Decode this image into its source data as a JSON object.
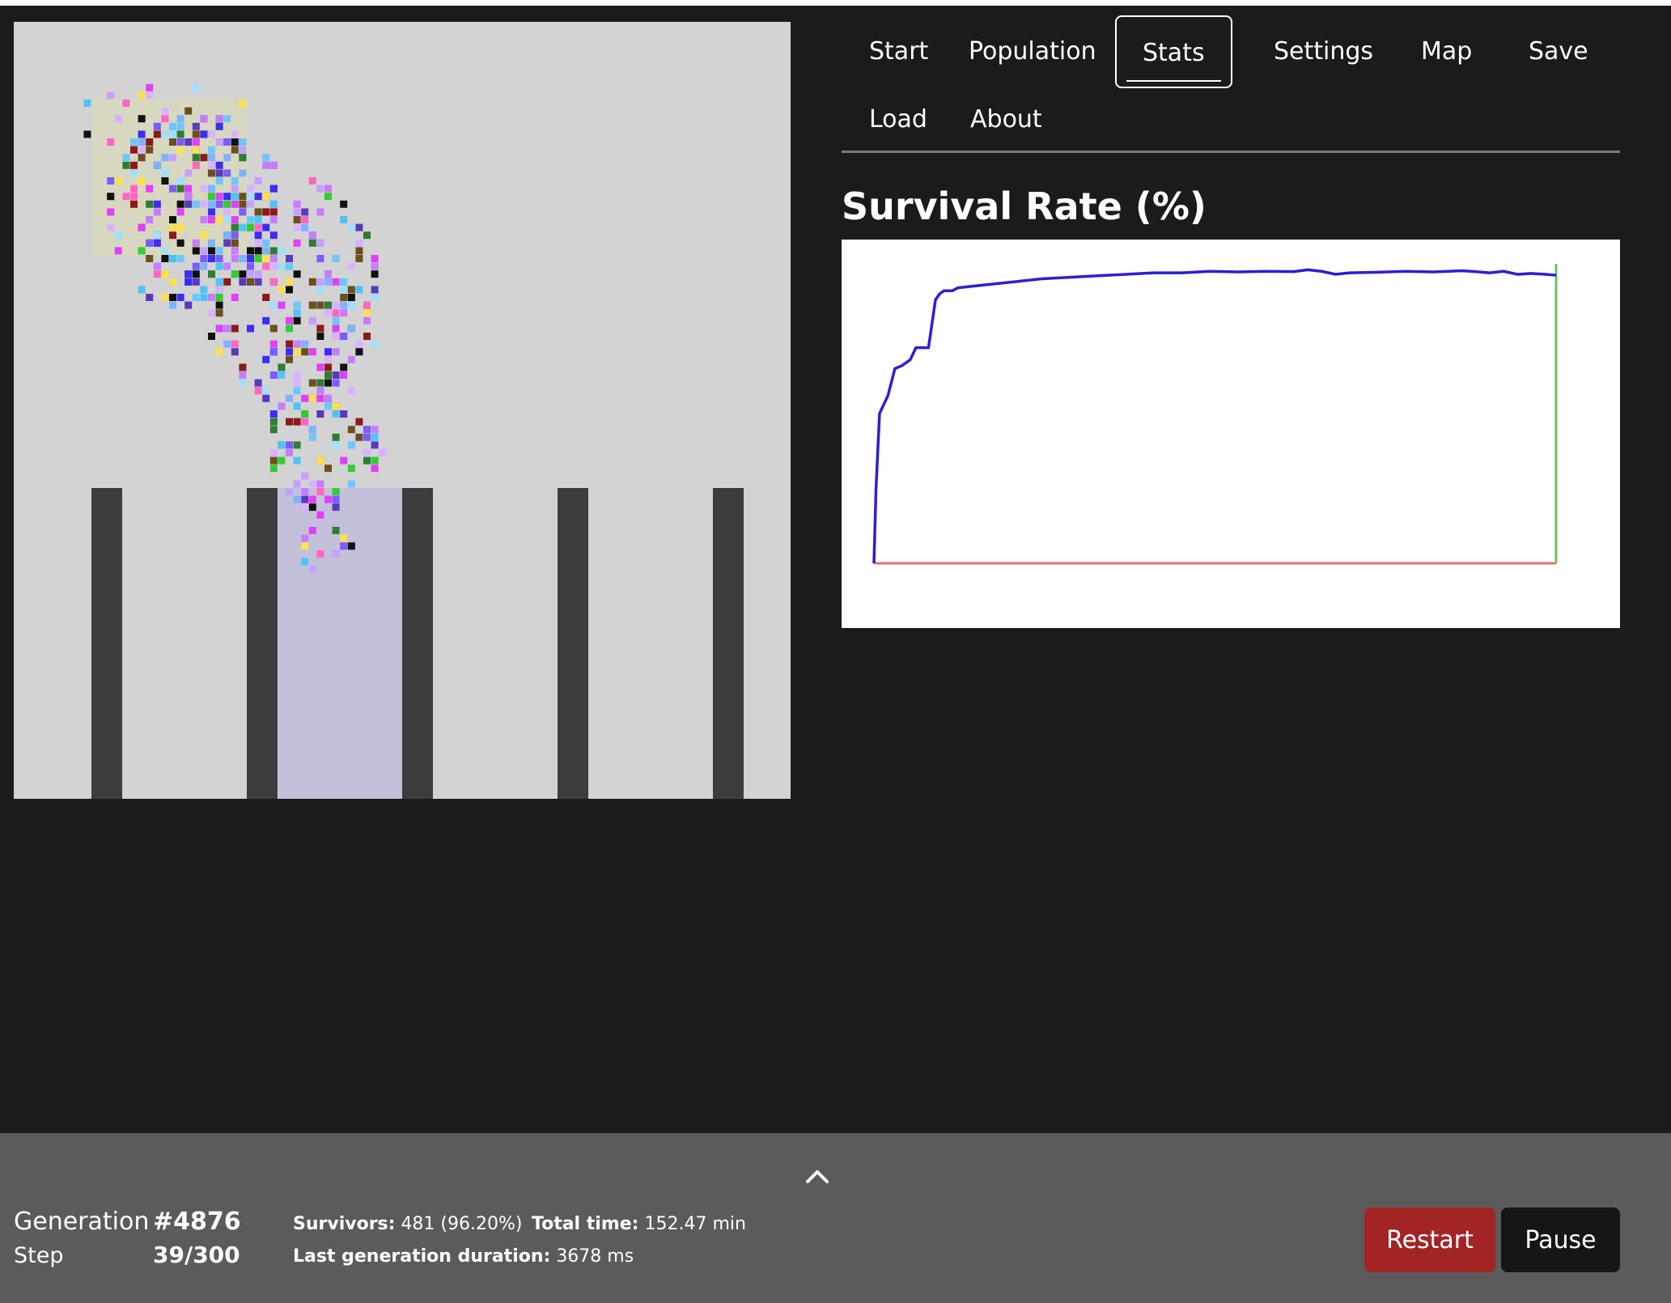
{
  "colors": {
    "page_bg": "#1b1b1b",
    "world_bg": "#d3d3d3",
    "wall": "#3c3c3c",
    "spawn_zone": "#d8d8c0",
    "goal_zone": "#c3c0da",
    "survival_line": "#2a1fd6",
    "chart_baseline": "#f06c6c",
    "chart_marker": "#6cbf5a",
    "restart_button": "#a32424",
    "pause_button": "#161616",
    "bottom_bar": "#5b5b5b"
  },
  "tabs": [
    {
      "label": "Start",
      "active": false
    },
    {
      "label": "Population",
      "active": false
    },
    {
      "label": "Stats",
      "active": true
    },
    {
      "label": "Settings",
      "active": false
    },
    {
      "label": "Map",
      "active": false
    },
    {
      "label": "Save",
      "active": false
    },
    {
      "label": "Load",
      "active": false
    },
    {
      "label": "About",
      "active": false
    }
  ],
  "chart_data": {
    "type": "line",
    "title": "Survival Rate (%)",
    "xlabel": "",
    "ylabel": "",
    "xlim": [
      0,
      4876
    ],
    "ylim": [
      0,
      100
    ],
    "grid": false,
    "series": [
      {
        "x": [
          0,
          15,
          40,
          60,
          100,
          150,
          200,
          260,
          300,
          390,
          440,
          470,
          500,
          560,
          600,
          700,
          800,
          1000,
          1200,
          1400,
          1600,
          1800,
          2000,
          2200,
          2400,
          2600,
          2800,
          3000,
          3100,
          3200,
          3300,
          3400,
          3600,
          3800,
          4000,
          4200,
          4300,
          4400,
          4500,
          4600,
          4700,
          4800,
          4876
        ],
        "y": [
          0,
          25,
          50,
          52,
          56,
          65,
          66,
          68,
          72,
          72,
          88,
          90,
          91,
          91,
          92,
          92.5,
          93,
          94,
          95,
          95.5,
          96,
          96.5,
          97,
          97,
          97.5,
          97.3,
          97.5,
          97.4,
          98,
          97.5,
          96.5,
          97,
          97.2,
          97.5,
          97.3,
          97.7,
          97.4,
          97,
          97.5,
          96.5,
          96.8,
          96.5,
          96.2
        ]
      }
    ]
  },
  "world": {
    "spawn_zone_label": "",
    "goal_zone_label": ""
  },
  "status": {
    "generation_label": "Generation",
    "generation_value": "#4876",
    "step_label": "Step",
    "step_value": "39/300",
    "survivors_label": "Survivors:",
    "survivors_value": "481 (96.20%)",
    "total_time_label": "Total time:",
    "total_time_value": "152.47 min",
    "last_gen_label": "Last generation duration:",
    "last_gen_value": "3678 ms",
    "collapse_icon": "chevron-up-icon"
  },
  "controls": {
    "restart_label": "Restart",
    "pause_label": "Pause"
  }
}
